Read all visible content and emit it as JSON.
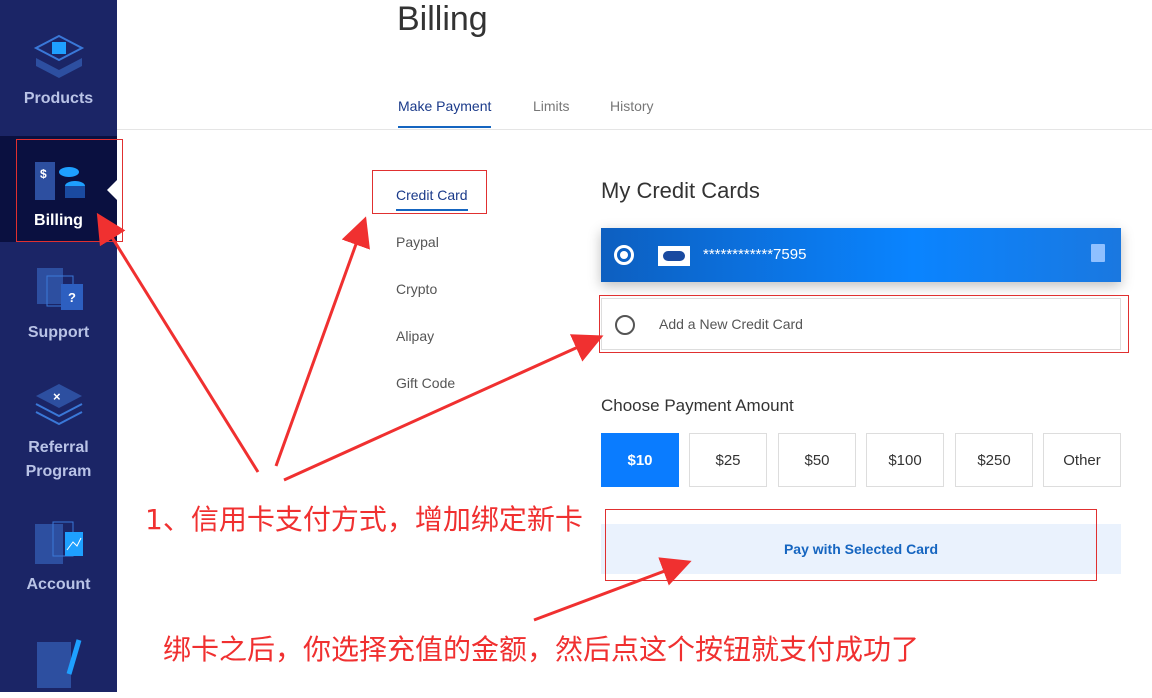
{
  "sidebar": {
    "items": [
      {
        "label": "Products"
      },
      {
        "label": "Billing",
        "active": true
      },
      {
        "label": "Support"
      },
      {
        "label": "Referral Program"
      },
      {
        "label": "Account"
      }
    ]
  },
  "page": {
    "title": "Billing"
  },
  "tabs": [
    {
      "label": "Make Payment",
      "active": true
    },
    {
      "label": "Limits"
    },
    {
      "label": "History"
    }
  ],
  "methods": [
    {
      "label": "Credit Card",
      "active": true
    },
    {
      "label": "Paypal"
    },
    {
      "label": "Crypto"
    },
    {
      "label": "Alipay"
    },
    {
      "label": "Gift Code"
    }
  ],
  "cards": {
    "heading": "My Credit Cards",
    "saved_card": "************7595",
    "add_new": "Add a New Credit Card"
  },
  "amount": {
    "label": "Choose Payment Amount",
    "options": [
      "$10",
      "$25",
      "$50",
      "$100",
      "$250",
      "Other"
    ],
    "selected": "$10"
  },
  "pay_button": "Pay with Selected Card",
  "annotations": {
    "note1": "1、信用卡支付方式，增加绑定新卡",
    "note2": "绑卡之后，你选择充值的金额，然后点这个按钮就支付成功了"
  },
  "colors": {
    "sidebar": "#1b2566",
    "accent": "#0a7cff",
    "annotation": "#f03030"
  }
}
